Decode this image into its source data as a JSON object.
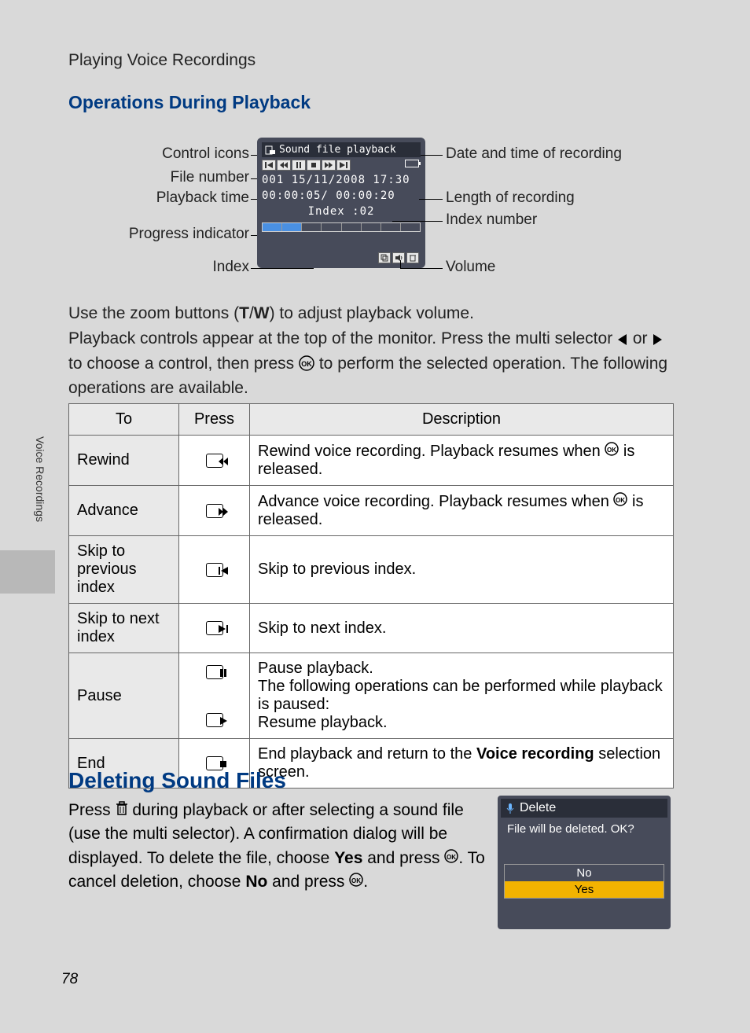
{
  "section_label": "Playing Voice Recordings",
  "heading_operations": "Operations During Playback",
  "diagram": {
    "monitor": {
      "title": "Sound file playback",
      "file_line": "001  15/11/2008 17:30",
      "time_line": "00:00:05/ 00:00:20",
      "index_line": "Index :02"
    },
    "left_labels": {
      "control_icons": "Control icons",
      "file_number": "File number",
      "playback_time": "Playback time",
      "progress_indicator": "Progress indicator",
      "index": "Index"
    },
    "right_labels": {
      "datetime": "Date and time of recording",
      "length": "Length of recording",
      "index_number": "Index number",
      "volume": "Volume"
    }
  },
  "paragraphs": {
    "p1_pre": "Use the zoom buttons (",
    "p1_t": "T",
    "p1_slash": "/",
    "p1_w": "W",
    "p1_post": ") to adjust playback volume.",
    "p2a": "Playback controls appear at the top of the monitor. Press the multi selector ",
    "p2b": " or ",
    "p2c": " to choose a control, then press ",
    "p2d": " to perform the selected operation. The following operations are available."
  },
  "table": {
    "headers": {
      "to": "To",
      "press": "Press",
      "desc": "Description"
    },
    "rows": [
      {
        "to": "Rewind",
        "icon": "rewind",
        "desc_pre": "Rewind voice recording. Playback resumes when ",
        "desc_post": " is released."
      },
      {
        "to": "Advance",
        "icon": "advance",
        "desc_pre": "Advance voice recording. Playback resumes when ",
        "desc_post": " is released."
      },
      {
        "to": "Skip to previous index",
        "icon": "skip-prev",
        "desc": "Skip to previous index."
      },
      {
        "to": "Skip to next index",
        "icon": "skip-next",
        "desc": "Skip to next index."
      },
      {
        "to": "Pause",
        "icon": "pause",
        "icon2": "play",
        "desc_l1": "Pause playback.",
        "desc_l2": "The following operations can be performed while playback is paused:",
        "desc_l3": "Resume playback."
      },
      {
        "to": "End",
        "icon": "stop",
        "desc_pre": "End playback and return to the ",
        "desc_bold": "Voice recording",
        "desc_post": " selection screen."
      }
    ]
  },
  "heading_deleting": "Deleting Sound Files",
  "delete_paragraph": {
    "a": "Press ",
    "b": " during playback or after selecting a sound file (use the multi selector). A confirmation dialog will be displayed. To delete the file, choose ",
    "yes": "Yes",
    "c": " and press ",
    "d": ". To cancel deletion, choose ",
    "no": "No",
    "e": " and press ",
    "f": "."
  },
  "dialog": {
    "title": "Delete",
    "message": "File will be deleted. OK?",
    "opt_no": "No",
    "opt_yes": "Yes"
  },
  "side_tab": "Voice Recordings",
  "page_number": "78"
}
